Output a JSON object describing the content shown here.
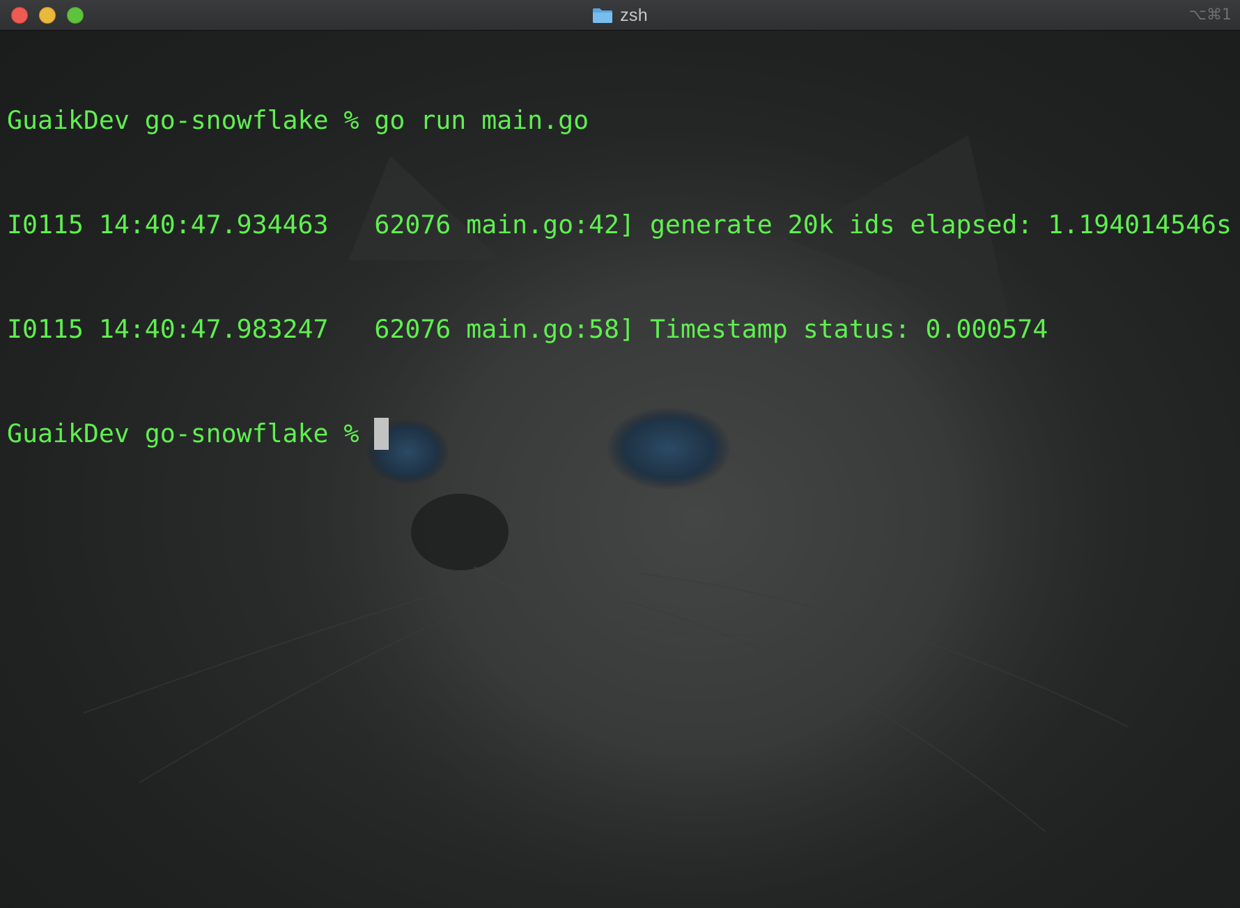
{
  "window": {
    "title": "zsh",
    "shortcut": "⌥⌘1",
    "folder_icon": "folder-icon",
    "traffic_lights": {
      "close_color": "#ee5b52",
      "minimize_color": "#e8b93a",
      "maximize_color": "#5fc23d"
    }
  },
  "terminal": {
    "text_color": "#5ff04f",
    "cursor_color": "#c3c3c3",
    "lines": [
      "GuaikDev go-snowflake % go run main.go",
      "I0115 14:40:47.934463   62076 main.go:42] generate 20k ids elapsed: 1.194014546s",
      "I0115 14:40:47.983247   62076 main.go:58] Timestamp status: 0.000574"
    ],
    "prompt": "GuaikDev go-snowflake %"
  }
}
